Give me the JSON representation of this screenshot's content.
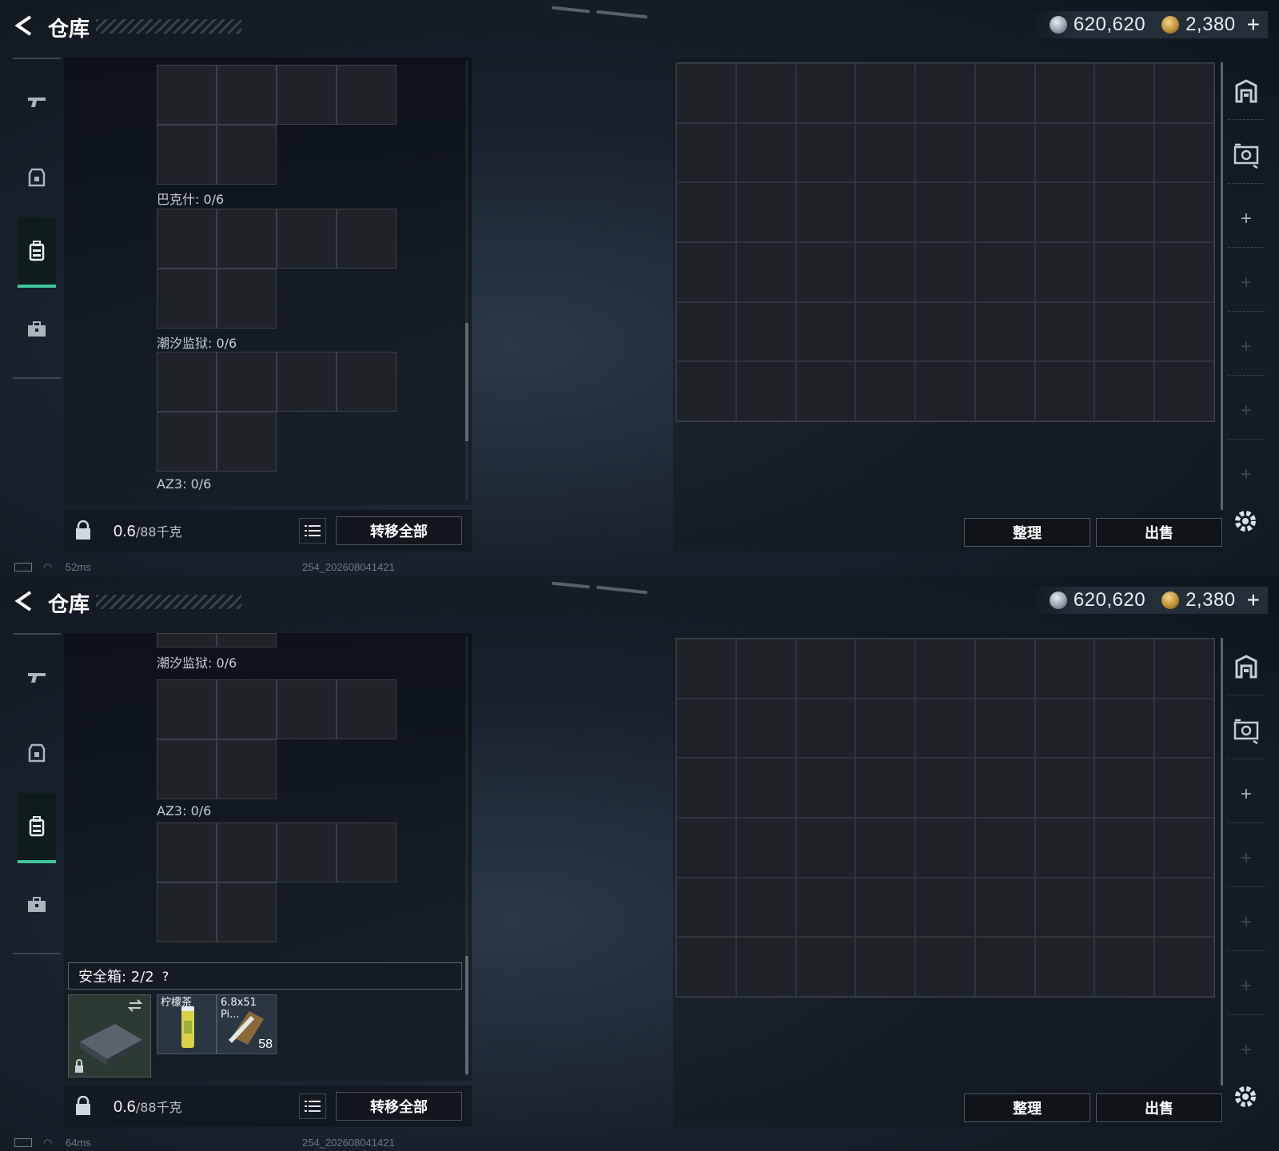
{
  "screens": [
    {
      "header": {
        "title": "仓库",
        "silver": "620,620",
        "gold": "2,380",
        "add": "+"
      },
      "groups": [
        {
          "label": "巴克什: 0/6"
        },
        {
          "label": "潮汐监狱: 0/6"
        },
        {
          "label": "AZ3: 0/6"
        }
      ],
      "weight": {
        "value": "0.6",
        "unit": "/88千克"
      },
      "buttons": {
        "transfer_all": "转移全部",
        "organize": "整理",
        "sell": "出售"
      },
      "status": {
        "ping": "52ms",
        "version": "254_202608041421"
      }
    },
    {
      "header": {
        "title": "仓库",
        "silver": "620,620",
        "gold": "2,380",
        "add": "+"
      },
      "groups": [
        {
          "label": "潮汐监狱: 0/6"
        },
        {
          "label": "AZ3: 0/6"
        }
      ],
      "safe_box": {
        "label": "安全箱:  2/2",
        "help": "?",
        "items": [
          {
            "name": "柠檬茶",
            "count": ""
          },
          {
            "name": "6.8x51 Pi...",
            "count": "58"
          }
        ]
      },
      "weight": {
        "value": "0.6",
        "unit": "/88千克"
      },
      "buttons": {
        "transfer_all": "转移全部",
        "organize": "整理",
        "sell": "出售"
      },
      "status": {
        "ping": "64ms",
        "version": "254_202608041421"
      }
    }
  ],
  "icons": {
    "left_nav": [
      "pistol-icon",
      "armor-icon",
      "backpack-icon",
      "toolbox-icon"
    ],
    "right_nav": [
      "stash-icon",
      "gallery-icon",
      "add-icon",
      "add-icon",
      "add-icon",
      "add-icon",
      "add-icon"
    ]
  },
  "colors": {
    "accent": "#3fc59a",
    "gold": "#b98a2e",
    "silver": "#8b98a4"
  }
}
